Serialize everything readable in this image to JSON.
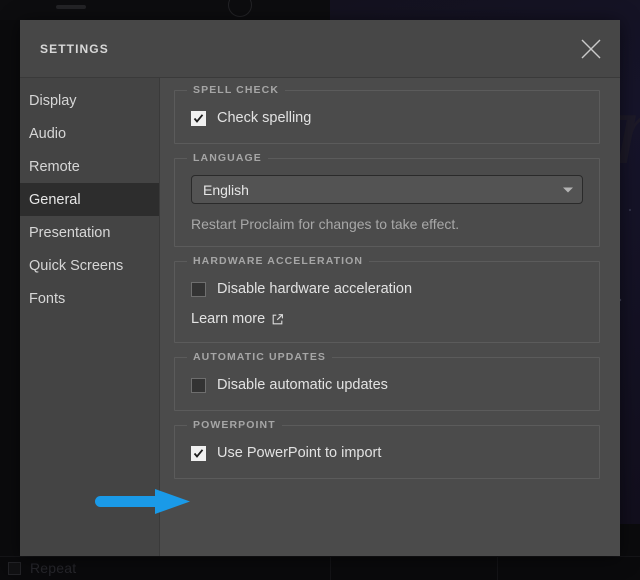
{
  "background": {
    "glyph": "n",
    "bottom_checkbox_label": "Repeat"
  },
  "modal": {
    "title": "SETTINGS",
    "close_icon": "close-icon"
  },
  "sidebar": {
    "items": [
      {
        "label": "Display",
        "selected": false
      },
      {
        "label": "Audio",
        "selected": false
      },
      {
        "label": "Remote",
        "selected": false
      },
      {
        "label": "General",
        "selected": true
      },
      {
        "label": "Presentation",
        "selected": false
      },
      {
        "label": "Quick Screens",
        "selected": false
      },
      {
        "label": "Fonts",
        "selected": false
      }
    ]
  },
  "content": {
    "spell_check": {
      "legend": "SPELL CHECK",
      "checkbox_label": "Check spelling",
      "checked": true
    },
    "language": {
      "legend": "LANGUAGE",
      "selected_option": "English",
      "options": [
        "English"
      ],
      "helper_text": "Restart Proclaim for changes to take effect."
    },
    "hardware_acceleration": {
      "legend": "HARDWARE ACCELERATION",
      "checkbox_label": "Disable hardware acceleration",
      "checked": false,
      "link_label": "Learn more",
      "link_icon": "external-link-icon"
    },
    "automatic_updates": {
      "legend": "AUTOMATIC UPDATES",
      "checkbox_label": "Disable automatic updates",
      "checked": false
    },
    "powerpoint": {
      "legend": "POWERPOINT",
      "checkbox_label": "Use PowerPoint to import",
      "checked": true
    }
  },
  "annotation": {
    "type": "arrow",
    "direction": "right",
    "color": "#1a9ae8",
    "points_to": "powerpoint-checkbox"
  }
}
